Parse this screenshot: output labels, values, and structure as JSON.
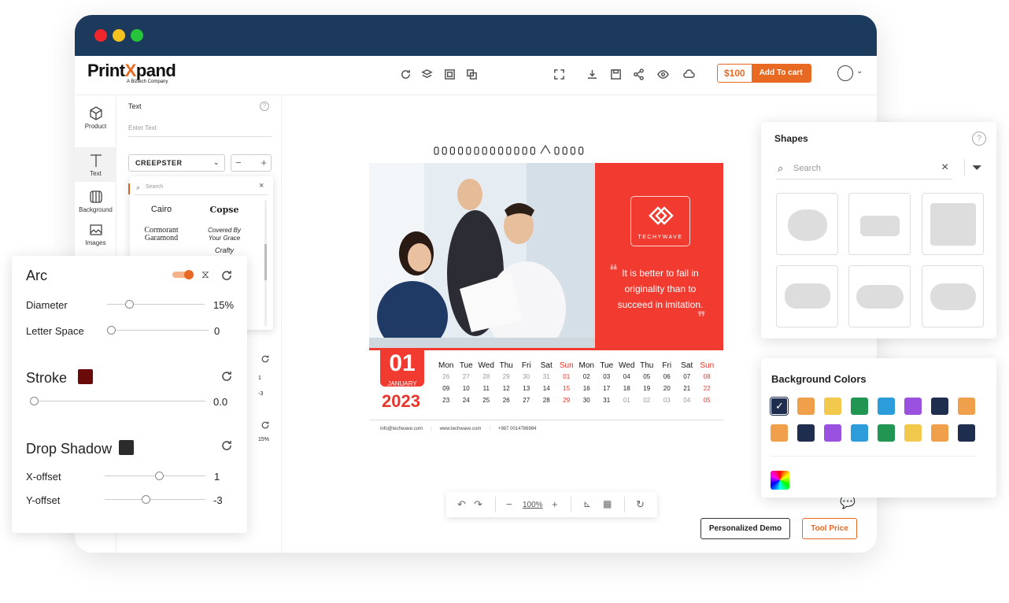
{
  "app": {
    "logo_main": "Print",
    "logo_x": "X",
    "logo_rest": "pand",
    "logo_sub": "A Biztech Company"
  },
  "header": {
    "price": "$100",
    "add_to_cart": "Add To cart"
  },
  "sidebar": {
    "items": [
      {
        "label": "Product"
      },
      {
        "label": "Text"
      },
      {
        "label": "Background"
      },
      {
        "label": "Images"
      }
    ]
  },
  "text_panel": {
    "title": "Text",
    "placeholder": "Enter Text",
    "font": "CREEPSTER",
    "search_placeholder": "Search",
    "fonts": [
      "Cairo",
      "Copse",
      "Cormorant Garamond",
      "Covered By Your Grace",
      "Crafty"
    ],
    "partial_values": [
      "1",
      "-3",
      "15%"
    ]
  },
  "arc": {
    "title": "Arc",
    "diameter_label": "Diameter",
    "diameter_value": "15%",
    "letter_space_label": "Letter Space",
    "letter_space_value": "0",
    "stroke_title": "Stroke",
    "stroke_value": "0.0",
    "stroke_color": "#6b0a0a",
    "shadow_title": "Drop Shadow",
    "shadow_color": "#2b2b2b",
    "xoffset_label": "X-offset",
    "xoffset_value": "1",
    "yoffset_label": "Y-offset",
    "yoffset_value": "-3",
    "diameter_pct": 0.2,
    "letter_space_pct": 0,
    "stroke_pct": 0,
    "xoffset_pct": 0.55,
    "yoffset_pct": 0.4
  },
  "calendar": {
    "day": "01",
    "month": "JANUARY",
    "year": "2023",
    "brand": "TECHYWAVE",
    "quote": "It is better to fail in originality than to succeed in imitation.",
    "email": "info@techwave.com",
    "web": "www.techwave.com",
    "phone": "+987 0014786984",
    "headers": [
      "Mon",
      "Tue",
      "Wed",
      "Thu",
      "Fri",
      "Sat",
      "Sun",
      "Mon",
      "Tue",
      "Wed",
      "Thu",
      "Fri",
      "Sat",
      "Sun"
    ],
    "rows": [
      [
        "26",
        "27",
        "28",
        "29",
        "30",
        "31",
        "01",
        "02",
        "03",
        "04",
        "05",
        "06",
        "07",
        "08"
      ],
      [
        "09",
        "10",
        "11",
        "12",
        "13",
        "14",
        "15",
        "16",
        "17",
        "18",
        "19",
        "20",
        "21",
        "22"
      ],
      [
        "23",
        "24",
        "25",
        "26",
        "27",
        "28",
        "29",
        "30",
        "31",
        "01",
        "02",
        "03",
        "04",
        "05"
      ]
    ]
  },
  "zoom": {
    "level": "100%"
  },
  "actions": {
    "demo": "Personalized Demo",
    "tool_price": "Tool Price"
  },
  "shapes": {
    "title": "Shapes",
    "search_placeholder": "Search"
  },
  "bg_colors": {
    "title": "Background Colors",
    "row1": [
      "#1f2d4e",
      "#f0a04b",
      "#f2c94c",
      "#219653",
      "#2d9cdb",
      "#9b51e0",
      "#1f2d4e",
      "#f0a04b"
    ],
    "row2": [
      "#f0a04b",
      "#1f2d4e",
      "#9b51e0",
      "#2d9cdb",
      "#219653",
      "#f2c94c",
      "#f0a04b",
      "#1f2d4e"
    ]
  },
  "colors": {
    "accent": "#e86a22",
    "red": "#f13a30",
    "navy": "#1c3a5c"
  }
}
